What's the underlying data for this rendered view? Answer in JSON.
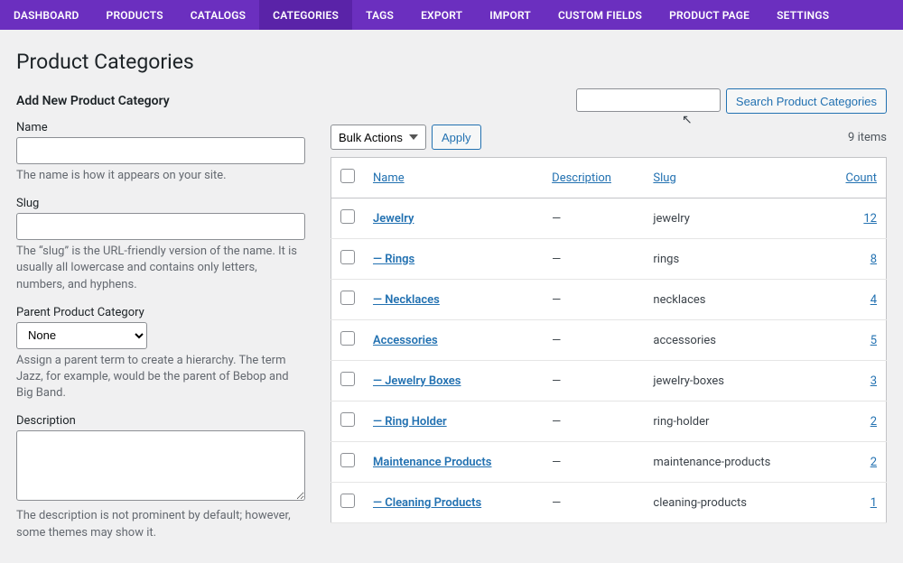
{
  "nav": {
    "items": [
      {
        "label": "DASHBOARD"
      },
      {
        "label": "PRODUCTS"
      },
      {
        "label": "CATALOGS"
      },
      {
        "label": "CATEGORIES"
      },
      {
        "label": "TAGS"
      },
      {
        "label": "EXPORT"
      },
      {
        "label": "IMPORT"
      },
      {
        "label": "CUSTOM FIELDS"
      },
      {
        "label": "PRODUCT PAGE"
      },
      {
        "label": "SETTINGS"
      }
    ],
    "active_index": 3
  },
  "page_title": "Product Categories",
  "form": {
    "heading": "Add New Product Category",
    "name": {
      "label": "Name",
      "value": "",
      "help": "The name is how it appears on your site."
    },
    "slug": {
      "label": "Slug",
      "value": "",
      "help": "The “slug” is the URL-friendly version of the name. It is usually all lowercase and contains only letters, numbers, and hyphens."
    },
    "parent": {
      "label": "Parent Product Category",
      "selected": "None",
      "help": "Assign a parent term to create a hierarchy. The term Jazz, for example, would be the parent of Bebop and Big Band."
    },
    "description": {
      "label": "Description",
      "value": "",
      "help": "The description is not prominent by default; however, some themes may show it."
    }
  },
  "search": {
    "button": "Search Product Categories"
  },
  "bulk": {
    "selected": "Bulk Actions",
    "apply": "Apply"
  },
  "items_count": "9 items",
  "table": {
    "headers": {
      "name": "Name",
      "description": "Description",
      "slug": "Slug",
      "count": "Count"
    },
    "rows": [
      {
        "name": "Jewelry",
        "desc": "—",
        "slug": "jewelry",
        "count": "12"
      },
      {
        "name": "— Rings",
        "desc": "—",
        "slug": "rings",
        "count": "8"
      },
      {
        "name": "— Necklaces",
        "desc": "—",
        "slug": "necklaces",
        "count": "4"
      },
      {
        "name": "Accessories",
        "desc": "—",
        "slug": "accessories",
        "count": "5"
      },
      {
        "name": "— Jewelry Boxes",
        "desc": "—",
        "slug": "jewelry-boxes",
        "count": "3"
      },
      {
        "name": "— Ring Holder",
        "desc": "—",
        "slug": "ring-holder",
        "count": "2"
      },
      {
        "name": "Maintenance Products",
        "desc": "—",
        "slug": "maintenance-products",
        "count": "2"
      },
      {
        "name": "— Cleaning Products",
        "desc": "—",
        "slug": "cleaning-products",
        "count": "1"
      }
    ]
  }
}
